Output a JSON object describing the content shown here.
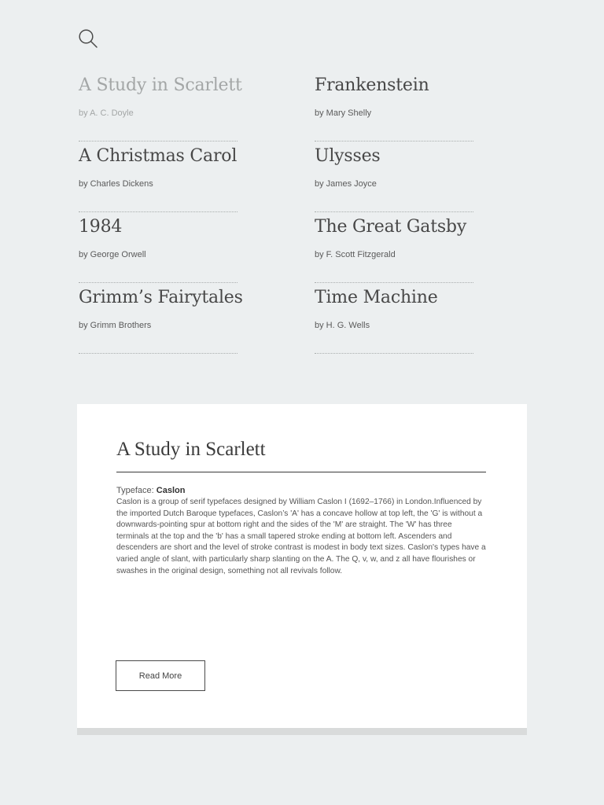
{
  "icons": {
    "search": "search-icon"
  },
  "colors": {
    "background": "#eceff0",
    "card": "#ffffff",
    "text": "#474747",
    "muted": "#a3a6a6"
  },
  "books": [
    {
      "title": "A Study in Scarlett",
      "author": "by A. C. Doyle",
      "active": true
    },
    {
      "title": "Frankenstein",
      "author": "by Mary Shelly",
      "active": false
    },
    {
      "title": "A Christmas Carol",
      "author": "by Charles Dickens",
      "active": false
    },
    {
      "title": "Ulysses",
      "author": "by James Joyce",
      "active": false
    },
    {
      "title": "1984",
      "author": "by George Orwell",
      "active": false
    },
    {
      "title": "The Great Gatsby",
      "author": "by F. Scott Fitzgerald",
      "active": false
    },
    {
      "title": "Grimm’s Fairytales",
      "author": "by Grimm Brothers",
      "active": false
    },
    {
      "title": "Time Machine",
      "author": "by H. G. Wells",
      "active": false
    }
  ],
  "detail": {
    "title": "A Study in Scarlett",
    "typeface_label": "Typeface:",
    "typeface_name": "Caslon",
    "body": "Caslon is a group of serif typefaces designed by William Caslon I (1692–1766) in London.Influenced by the imported Dutch Baroque typefaces, Caslon’s 'A' has a concave hollow at top left, the 'G' is without a downwards-pointing spur at bottom right and the sides of the 'M' are straight. The 'W' has three terminals at the top and the 'b' has a small tapered stroke ending at bottom left. Ascenders and descenders are short and the level of stroke contrast is modest in body text sizes. Caslon's types have a varied angle of slant, with particularly sharp slanting on the A. The Q, v, w, and z all have flourishes or swashes in the original design, something not all revivals follow.",
    "read_more_label": "Read More"
  }
}
